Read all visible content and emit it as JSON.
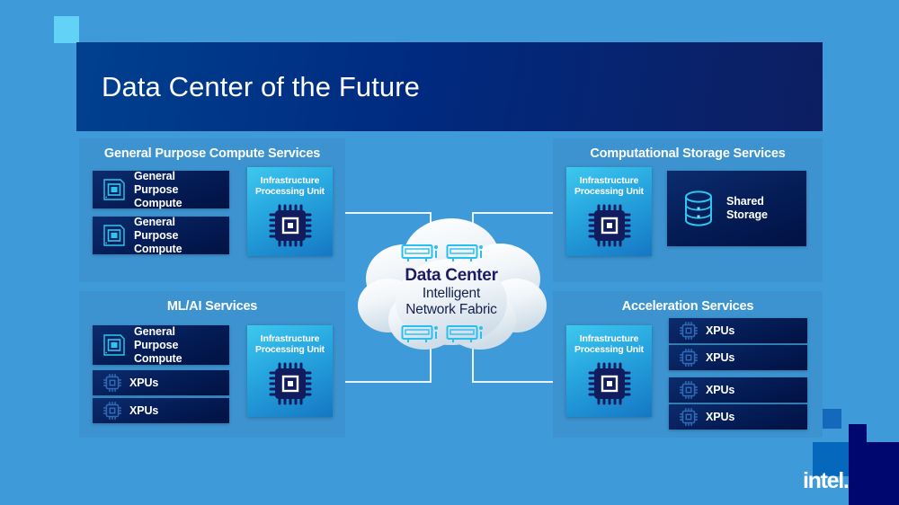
{
  "slide": {
    "title": "Data Center of the Future",
    "brand": "intel",
    "brand_dot": ".",
    "background_color": "#3f9ad9",
    "title_gradient_from": "#00418f",
    "title_gradient_to": "#0d1e61",
    "accent_cyan": "#62d3f7",
    "navy": "#00076e"
  },
  "panels": {
    "general_purpose_compute_services": {
      "title": "General Purpose Compute Services",
      "nodes": [
        {
          "label_line1": "General",
          "label_line2": "Purpose Compute",
          "icon": "cpu-chip-icon"
        },
        {
          "label_line1": "General",
          "label_line2": "Purpose Compute",
          "icon": "cpu-chip-icon"
        }
      ],
      "ipu": {
        "label_line1": "Infrastructure",
        "label_line2": "Processing Unit",
        "icon": "processor-chip-icon"
      }
    },
    "ml_ai_services": {
      "title": "ML/AI Services",
      "nodes": [
        {
          "label_line1": "General",
          "label_line2": "Purpose Compute",
          "icon": "cpu-chip-icon"
        },
        {
          "label_line1": "XPUs",
          "label_line2": "",
          "icon": "xpu-chip-icon"
        },
        {
          "label_line1": "XPUs",
          "label_line2": "",
          "icon": "xpu-chip-icon"
        }
      ],
      "ipu": {
        "label_line1": "Infrastructure",
        "label_line2": "Processing Unit",
        "icon": "processor-chip-icon"
      }
    },
    "computational_storage_services": {
      "title": "Computational Storage Services",
      "ipu": {
        "label_line1": "Infrastructure",
        "label_line2": "Processing Unit",
        "icon": "processor-chip-icon"
      },
      "nodes": [
        {
          "label_line1": "Shared",
          "label_line2": "Storage",
          "icon": "database-cylinder-icon"
        }
      ]
    },
    "acceleration_services": {
      "title": "Acceleration Services",
      "ipu": {
        "label_line1": "Infrastructure",
        "label_line2": "Processing Unit",
        "icon": "processor-chip-icon"
      },
      "nodes": [
        {
          "label_line1": "XPUs",
          "label_line2": "",
          "icon": "xpu-chip-icon"
        },
        {
          "label_line1": "XPUs",
          "label_line2": "",
          "icon": "xpu-chip-icon"
        },
        {
          "label_line1": "XPUs",
          "label_line2": "",
          "icon": "xpu-chip-icon"
        },
        {
          "label_line1": "XPUs",
          "label_line2": "",
          "icon": "xpu-chip-icon"
        }
      ]
    }
  },
  "cloud": {
    "title": "Data Center",
    "subtitle_line1": "Intelligent",
    "subtitle_line2": "Network Fabric",
    "icons": [
      "network-switch-icon",
      "network-switch-icon",
      "network-switch-icon",
      "network-switch-icon"
    ]
  }
}
